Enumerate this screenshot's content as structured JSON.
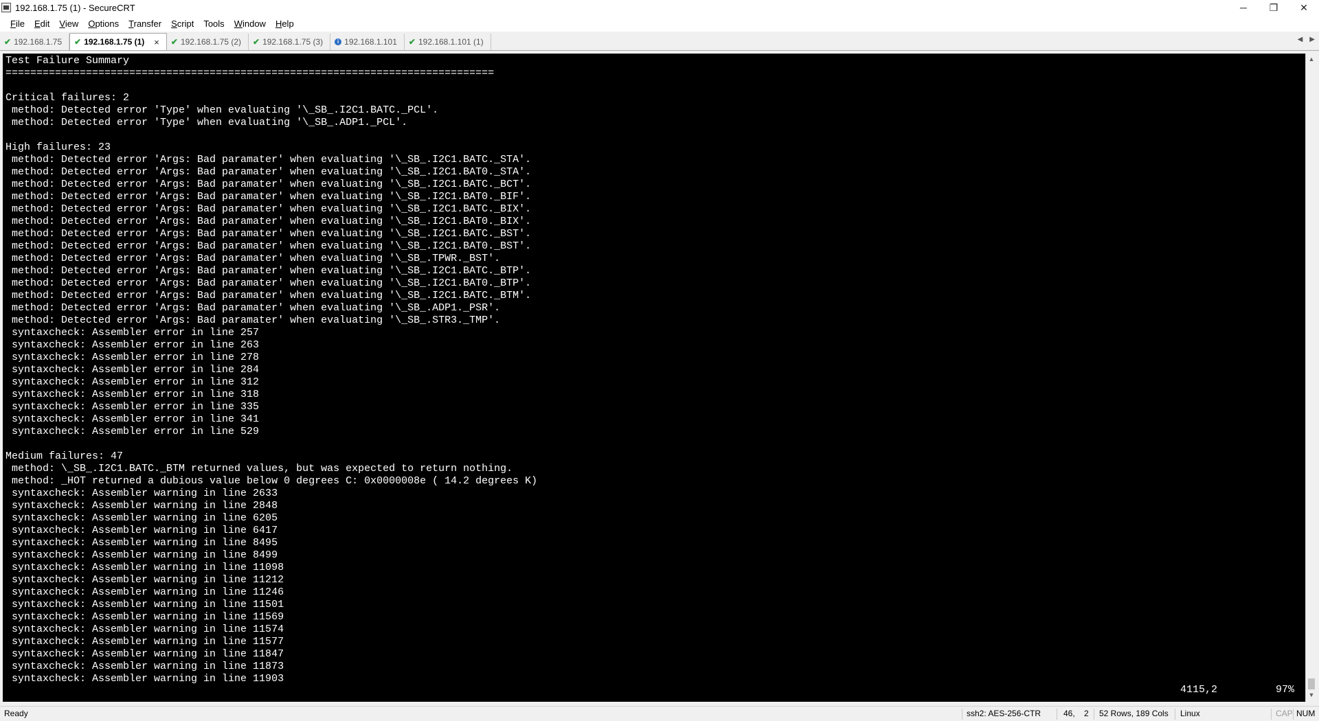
{
  "window": {
    "title": "192.168.1.75 (1) - SecureCRT",
    "controls": {
      "minimize": "─",
      "restore": "❐",
      "close": "✕"
    }
  },
  "menu": [
    {
      "label": "File",
      "accel": "F",
      "rest": "ile"
    },
    {
      "label": "Edit",
      "accel": "E",
      "rest": "dit"
    },
    {
      "label": "View",
      "accel": "V",
      "rest": "iew"
    },
    {
      "label": "Options",
      "accel": "O",
      "rest": "ptions"
    },
    {
      "label": "Transfer",
      "accel": "T",
      "rest": "ransfer"
    },
    {
      "label": "Script",
      "accel": "S",
      "rest": "cript"
    },
    {
      "label": "Tools",
      "accel": "",
      "rest": "Tools"
    },
    {
      "label": "Window",
      "accel": "W",
      "rest": "indow"
    },
    {
      "label": "Help",
      "accel": "H",
      "rest": "elp"
    }
  ],
  "tabs": [
    {
      "label": "192.168.1.75",
      "icon": "check-icon",
      "active": false
    },
    {
      "label": "192.168.1.75 (1)",
      "icon": "check-icon",
      "active": true,
      "close": "×"
    },
    {
      "label": "192.168.1.75 (2)",
      "icon": "check-icon",
      "active": false
    },
    {
      "label": "192.168.1.75 (3)",
      "icon": "check-icon",
      "active": false
    },
    {
      "label": "192.168.1.101",
      "icon": "info-icon",
      "active": false
    },
    {
      "label": "192.168.1.101 (1)",
      "icon": "check-icon",
      "active": false
    }
  ],
  "tab_scroll": {
    "left": "◀",
    "right": "▶"
  },
  "terminal": {
    "lines": [
      "Test Failure Summary",
      "===============================================================================",
      "",
      "Critical failures: 2",
      " method: Detected error 'Type' when evaluating '\\_SB_.I2C1.BATC._PCL'.",
      " method: Detected error 'Type' when evaluating '\\_SB_.ADP1._PCL'.",
      "",
      "High failures: 23",
      " method: Detected error 'Args: Bad paramater' when evaluating '\\_SB_.I2C1.BATC._STA'.",
      " method: Detected error 'Args: Bad paramater' when evaluating '\\_SB_.I2C1.BAT0._STA'.",
      " method: Detected error 'Args: Bad paramater' when evaluating '\\_SB_.I2C1.BATC._BCT'.",
      " method: Detected error 'Args: Bad paramater' when evaluating '\\_SB_.I2C1.BAT0._BIF'.",
      " method: Detected error 'Args: Bad paramater' when evaluating '\\_SB_.I2C1.BATC._BIX'.",
      " method: Detected error 'Args: Bad paramater' when evaluating '\\_SB_.I2C1.BAT0._BIX'.",
      " method: Detected error 'Args: Bad paramater' when evaluating '\\_SB_.I2C1.BATC._BST'.",
      " method: Detected error 'Args: Bad paramater' when evaluating '\\_SB_.I2C1.BAT0._BST'.",
      " method: Detected error 'Args: Bad paramater' when evaluating '\\_SB_.TPWR._BST'.",
      " method: Detected error 'Args: Bad paramater' when evaluating '\\_SB_.I2C1.BATC._BTP'.",
      " method: Detected error 'Args: Bad paramater' when evaluating '\\_SB_.I2C1.BAT0._BTP'.",
      " method: Detected error 'Args: Bad paramater' when evaluating '\\_SB_.I2C1.BATC._BTM'.",
      " method: Detected error 'Args: Bad paramater' when evaluating '\\_SB_.ADP1._PSR'.",
      " method: Detected error 'Args: Bad paramater' when evaluating '\\_SB_.STR3._TMP'.",
      " syntaxcheck: Assembler error in line 257",
      " syntaxcheck: Assembler error in line 263",
      " syntaxcheck: Assembler error in line 278",
      " syntaxcheck: Assembler error in line 284",
      " syntaxcheck: Assembler error in line 312",
      " syntaxcheck: Assembler error in line 318",
      " syntaxcheck: Assembler error in line 335",
      " syntaxcheck: Assembler error in line 341",
      " syntaxcheck: Assembler error in line 529",
      "",
      "Medium failures: 47",
      " method: \\_SB_.I2C1.BATC._BTM returned values, but was expected to return nothing.",
      " method: _HOT returned a dubious value below 0 degrees C: 0x0000008e ( 14.2 degrees K)",
      " syntaxcheck: Assembler warning in line 2633",
      " syntaxcheck: Assembler warning in line 2848",
      " syntaxcheck: Assembler warning in line 6205",
      " syntaxcheck: Assembler warning in line 6417",
      " syntaxcheck: Assembler warning in line 8495",
      " syntaxcheck: Assembler warning in line 8499",
      " syntaxcheck: Assembler warning in line 11098",
      " syntaxcheck: Assembler warning in line 11212",
      " syntaxcheck: Assembler warning in line 11246",
      " syntaxcheck: Assembler warning in line 11501",
      " syntaxcheck: Assembler warning in line 11569",
      " syntaxcheck: Assembler warning in line 11574",
      " syntaxcheck: Assembler warning in line 11577",
      " syntaxcheck: Assembler warning in line 11847",
      " syntaxcheck: Assembler warning in line 11873",
      " syntaxcheck: Assembler warning in line 11903"
    ],
    "cursor_position": "4115,2",
    "scroll_percent": "97%"
  },
  "scrollbar": {
    "up": "▲",
    "down": "▼"
  },
  "statusbar": {
    "ready": "Ready",
    "cipher": "ssh2: AES-256-CTR",
    "row": "46,",
    "col": "2",
    "dimensions": "52 Rows, 189 Cols",
    "os": "Linux",
    "cap": "CAP",
    "num": "NUM"
  }
}
